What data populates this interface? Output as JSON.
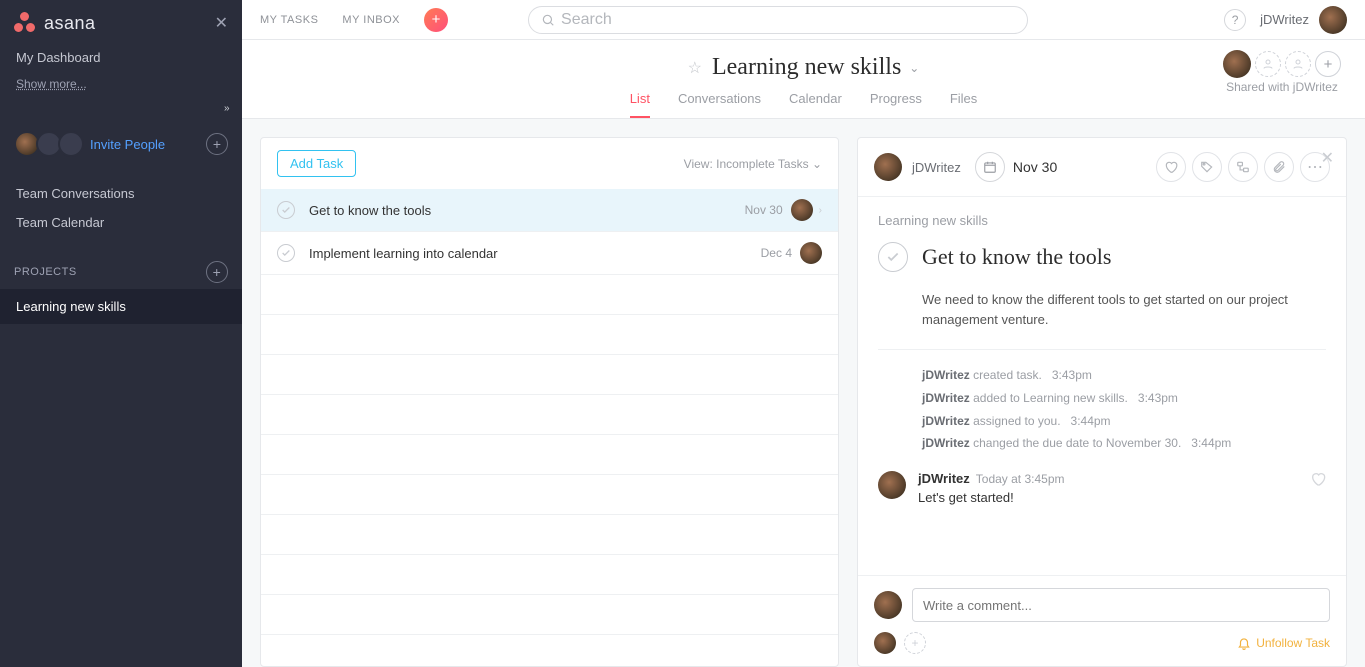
{
  "app": {
    "name": "asana"
  },
  "sidebar": {
    "dashboard": "My Dashboard",
    "show_more": "Show more...",
    "invite": "Invite People",
    "team_conversations": "Team Conversations",
    "team_calendar": "Team Calendar",
    "projects_header": "PROJECTS",
    "projects": [
      {
        "label": "Learning new skills",
        "active": true
      }
    ]
  },
  "topbar": {
    "my_tasks": "MY TASKS",
    "my_inbox": "MY INBOX",
    "search_placeholder": "Search",
    "user": "jDWritez"
  },
  "project_header": {
    "title": "Learning new skills",
    "shared_with": "Shared with jDWritez",
    "tabs": [
      {
        "label": "List",
        "active": true
      },
      {
        "label": "Conversations"
      },
      {
        "label": "Calendar"
      },
      {
        "label": "Progress"
      },
      {
        "label": "Files"
      }
    ]
  },
  "tasks": {
    "add_task": "Add Task",
    "view_label": "View: Incomplete Tasks",
    "rows": [
      {
        "title": "Get to know the tools",
        "due": "Nov 30",
        "selected": true
      },
      {
        "title": "Implement learning into calendar",
        "due": "Dec 4",
        "selected": false
      }
    ]
  },
  "detail": {
    "assignee": "jDWritez",
    "due": "Nov 30",
    "project": "Learning new skills",
    "title": "Get to know the tools",
    "description": "We need to know the different tools to get started on our project management venture.",
    "activity": [
      {
        "actor": "jDWritez",
        "text": "created task.",
        "time": "3:43pm"
      },
      {
        "actor": "jDWritez",
        "text": "added to Learning new skills.",
        "time": "3:43pm"
      },
      {
        "actor": "jDWritez",
        "text": "assigned to you.",
        "time": "3:44pm"
      },
      {
        "actor": "jDWritez",
        "text": "changed the due date to November 30.",
        "time": "3:44pm"
      }
    ],
    "comment": {
      "author": "jDWritez",
      "when": "Today at 3:45pm",
      "body": "Let's get started!"
    },
    "compose_placeholder": "Write a comment...",
    "unfollow": "Unfollow Task"
  }
}
